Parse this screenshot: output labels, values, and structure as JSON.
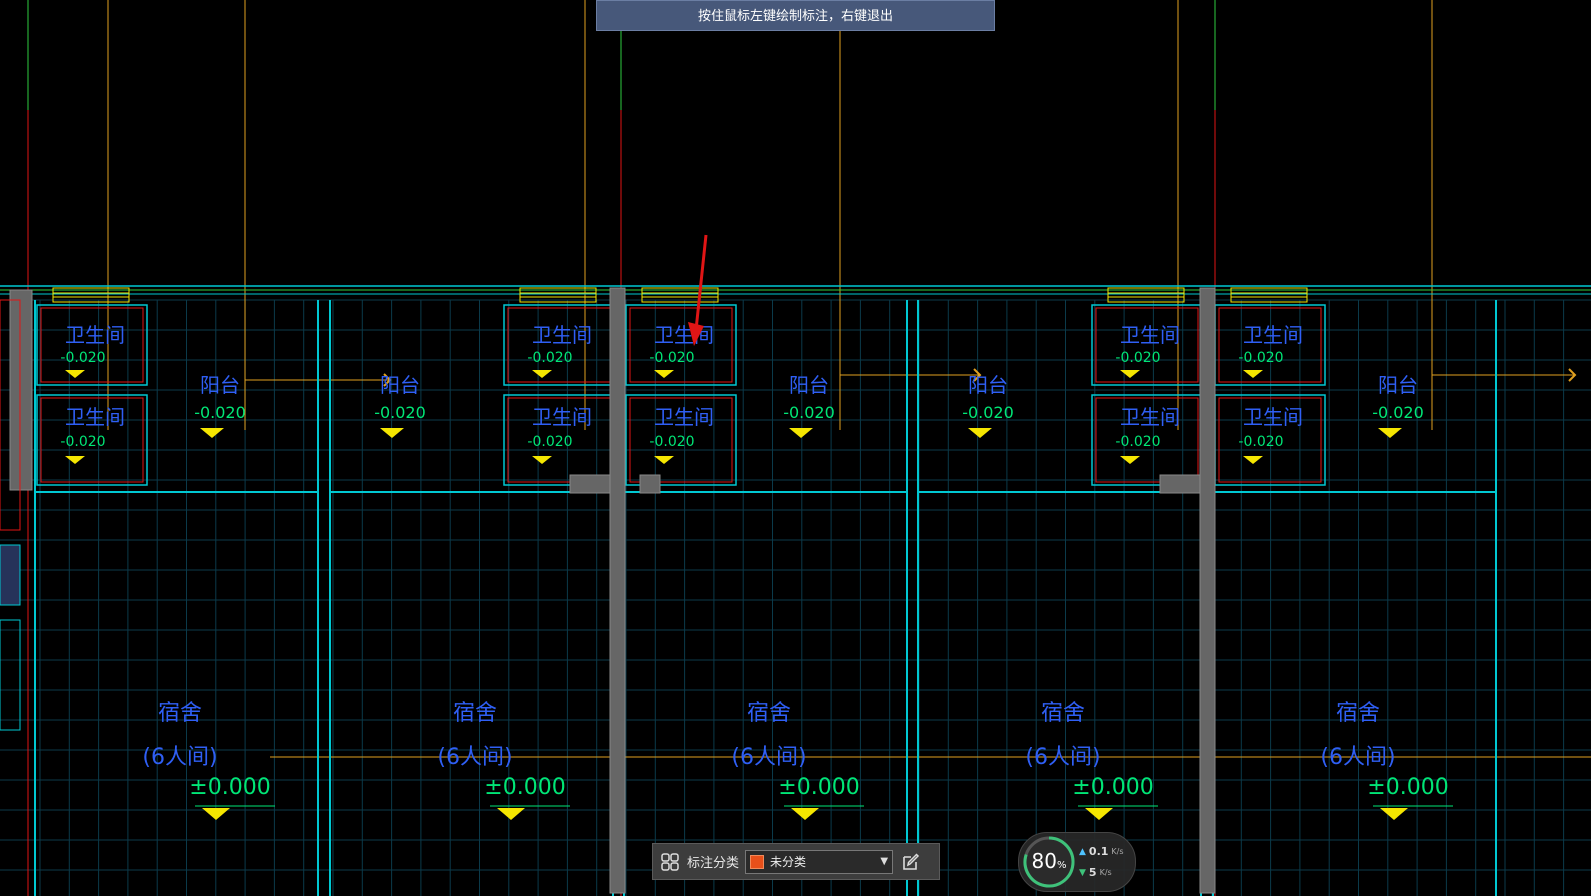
{
  "hint": {
    "text": "按住鼠标左键绘制标注，右键退出"
  },
  "rooms": {
    "bathroom": "卫生间",
    "balcony": "阳台",
    "dorm": "宿舍",
    "dorm_sub": "(6人间)"
  },
  "levels": {
    "wet": "-0.020",
    "floor": "±0.000"
  },
  "toolbar": {
    "grid_icon": "grid-icon",
    "label": "标注分类",
    "category_value": "未分类",
    "category_color": "#e8501a",
    "edit_icon": "edit-icon"
  },
  "net_widget": {
    "percent": "80",
    "percent_symbol": "%",
    "up_value": "0.1",
    "up_unit": "K/s",
    "down_value": "5",
    "down_unit": "K/s"
  },
  "colors": {
    "background": "#000000",
    "wall": "#00c8d2",
    "grid": "#0b3a4a",
    "axis": "#e0a020",
    "text_blue": "#2f5ff5",
    "text_green": "#00e676",
    "level_yellow": "#f5e600",
    "red": "#e01515",
    "hint_bg": "#47587a"
  }
}
